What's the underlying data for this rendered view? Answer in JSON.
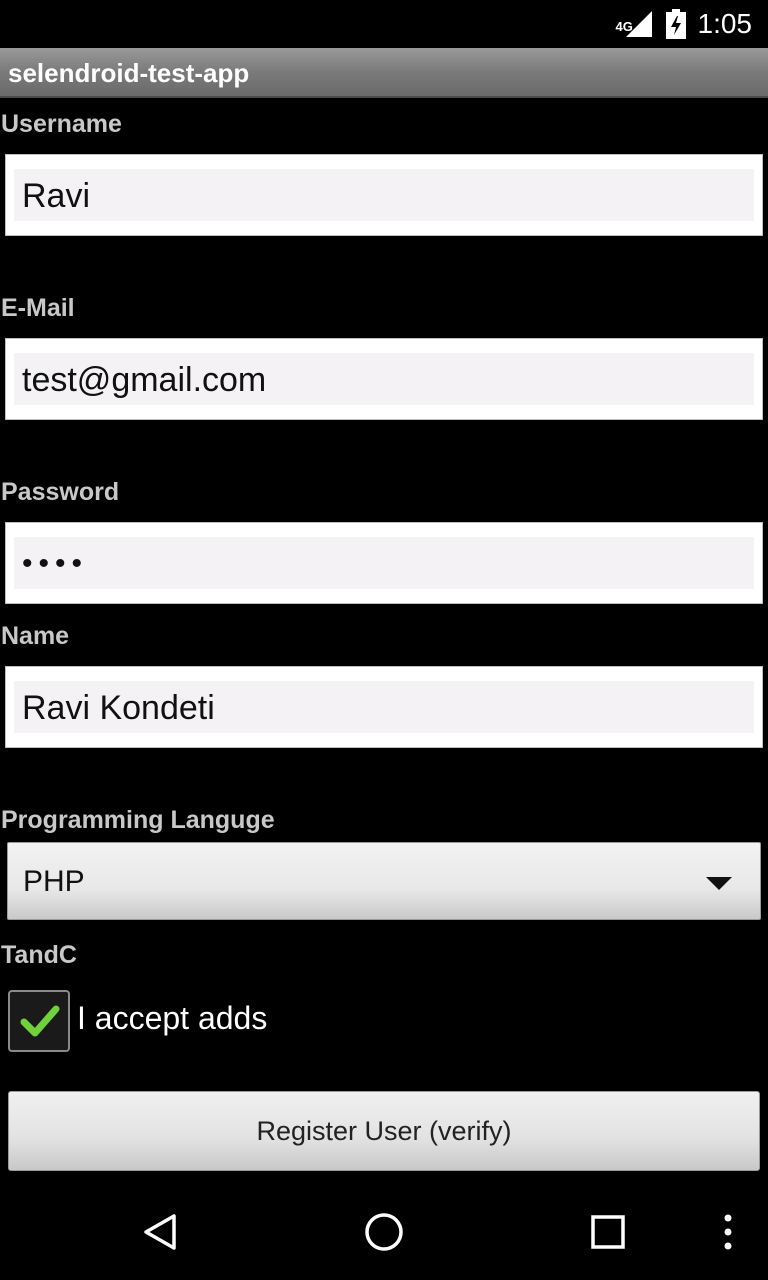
{
  "status_bar": {
    "network": "4G",
    "time": "1:05"
  },
  "app": {
    "title": "selendroid-test-app"
  },
  "form": {
    "username": {
      "label": "Username",
      "value": "Ravi"
    },
    "email": {
      "label": "E-Mail",
      "value": "test@gmail.com"
    },
    "password": {
      "label": "Password",
      "masked_value": "••••"
    },
    "name": {
      "label": "Name",
      "value": "Ravi Kondeti"
    },
    "language": {
      "label": "Programming Languge",
      "selected": "PHP"
    },
    "tandc": {
      "label": "TandC",
      "checkbox_label": "I accept adds",
      "checked": true
    },
    "register_button": "Register User (verify)"
  },
  "colors": {
    "background": "#000000",
    "title_bar": "#8a8a8a",
    "label": "#c8c8c8",
    "check_green": "#6fd13c"
  },
  "nav": {
    "icons": [
      "back-icon",
      "home-icon",
      "recents-icon",
      "overflow-menu-icon"
    ]
  }
}
